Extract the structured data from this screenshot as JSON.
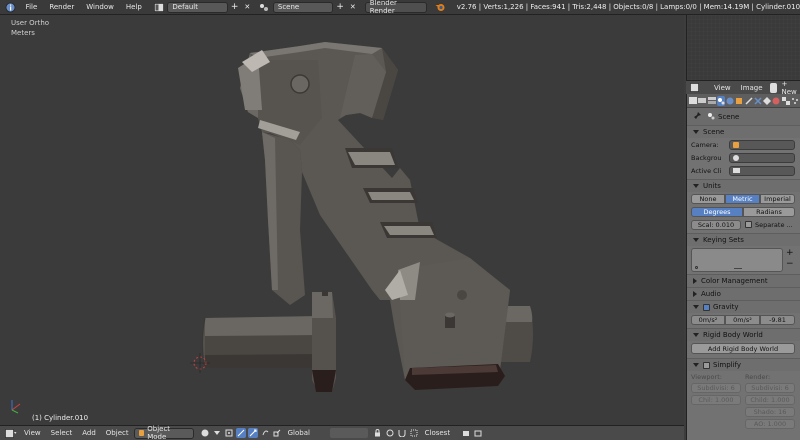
{
  "topbar": {
    "menus": [
      "File",
      "Render",
      "Window",
      "Help"
    ],
    "screen_layout": "Default",
    "scene": "Scene",
    "engine": "Blender Render",
    "stats": "v2.76 | Verts:1,226 | Faces:941 | Tris:2,448 | Objects:0/8 | Lamps:0/0 | Mem:14.19M | Cylinder.010",
    "add_symbol": "+",
    "close_symbol": "✕"
  },
  "viewport": {
    "view_name": "User Ortho",
    "units": "Meters",
    "object_name": "(1) Cylinder.010"
  },
  "viewport_header": {
    "menus": [
      "View",
      "Select",
      "Add",
      "Object"
    ],
    "mode": "Object Mode",
    "orientation": "Global",
    "snap_target": "Closest"
  },
  "uv_header": {
    "menus": [
      "View",
      "Image"
    ],
    "new_label": "New"
  },
  "properties": {
    "breadcrumb": "Scene",
    "scene_panel": {
      "title": "Scene",
      "camera_label": "Camera:",
      "background_label": "Backgrou",
      "active_clip_label": "Active Cli"
    },
    "units_panel": {
      "title": "Units",
      "systems": [
        "None",
        "Metric",
        "Imperial"
      ],
      "active_system": "Metric",
      "rotation": [
        "Degrees",
        "Radians"
      ],
      "active_rotation": "Degrees",
      "scale": "Scal: 0.010",
      "separate": "Separate ..."
    },
    "keying_sets_panel": {
      "title": "Keying Sets",
      "add": "+",
      "remove": "−"
    },
    "color_management_panel": {
      "title": "Color Management"
    },
    "audio_panel": {
      "title": "Audio"
    },
    "gravity_panel": {
      "title": "Gravity",
      "x": "0m/s²",
      "y": "0m/s²",
      "z": "-9.81"
    },
    "rigid_body_panel": {
      "title": "Rigid Body World",
      "button": "Add Rigid Body World"
    },
    "simplify_panel": {
      "title": "Simplify",
      "viewport_label": "Viewport:",
      "render_label": "Render:",
      "viewport_subdiv": "Subdivisi: 6",
      "viewport_child": "Chil: 1.000",
      "render_subdiv": "Subdivisi: 6",
      "render_child": "Child: 1.000",
      "render_shadow": "Shado: 16",
      "render_ao": "AO: 1.000"
    }
  },
  "colors": {
    "accent_blue": "#5680c2",
    "viewport_bg": "#3b3b3b",
    "panel_bg": "#727272"
  }
}
